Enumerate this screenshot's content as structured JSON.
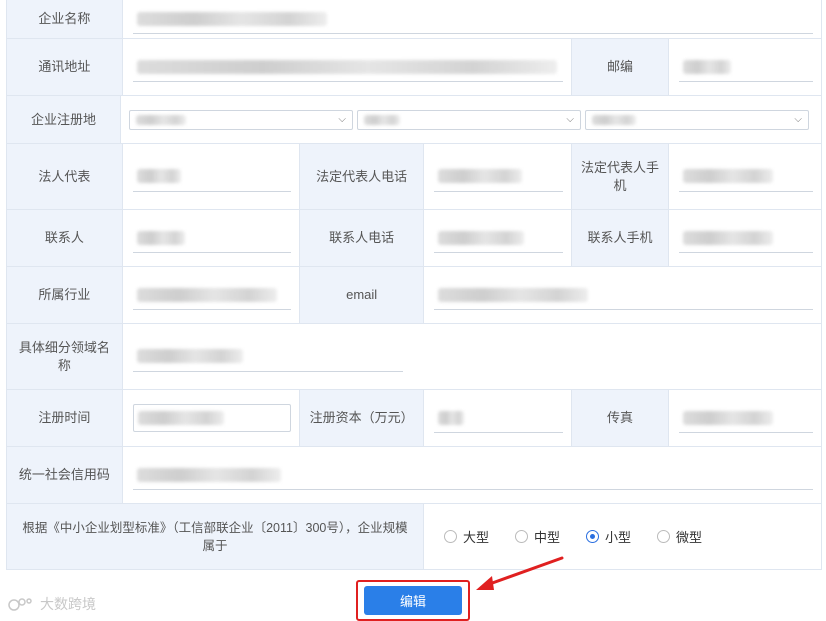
{
  "form": {
    "company_name": "企业名称",
    "address": "通讯地址",
    "postcode": "邮编",
    "reg_place": "企业注册地",
    "legal_rep": "法人代表",
    "legal_rep_phone": "法定代表人电话",
    "legal_rep_mobile": "法定代表人手机",
    "contact": "联系人",
    "contact_phone": "联系人电话",
    "contact_mobile": "联系人手机",
    "industry": "所属行业",
    "email": "email",
    "sub_field": "具体细分领域名称",
    "reg_time": "注册时间",
    "reg_capital": "注册资本（万元）",
    "fax": "传真",
    "credit_code": "统一社会信用码",
    "scale_question": "根据《中小企业划型标准》（工信部联企业〔2011〕300号），企业规模属于",
    "scale_options": [
      "大型",
      "中型",
      "小型",
      "微型"
    ],
    "scale_selected": "小型"
  },
  "edit_button": "编辑",
  "watermark": "大数跨境",
  "colors": {
    "accent": "#2a7fe8",
    "highlight": "#e02020",
    "label_bg": "#eef3fb"
  }
}
